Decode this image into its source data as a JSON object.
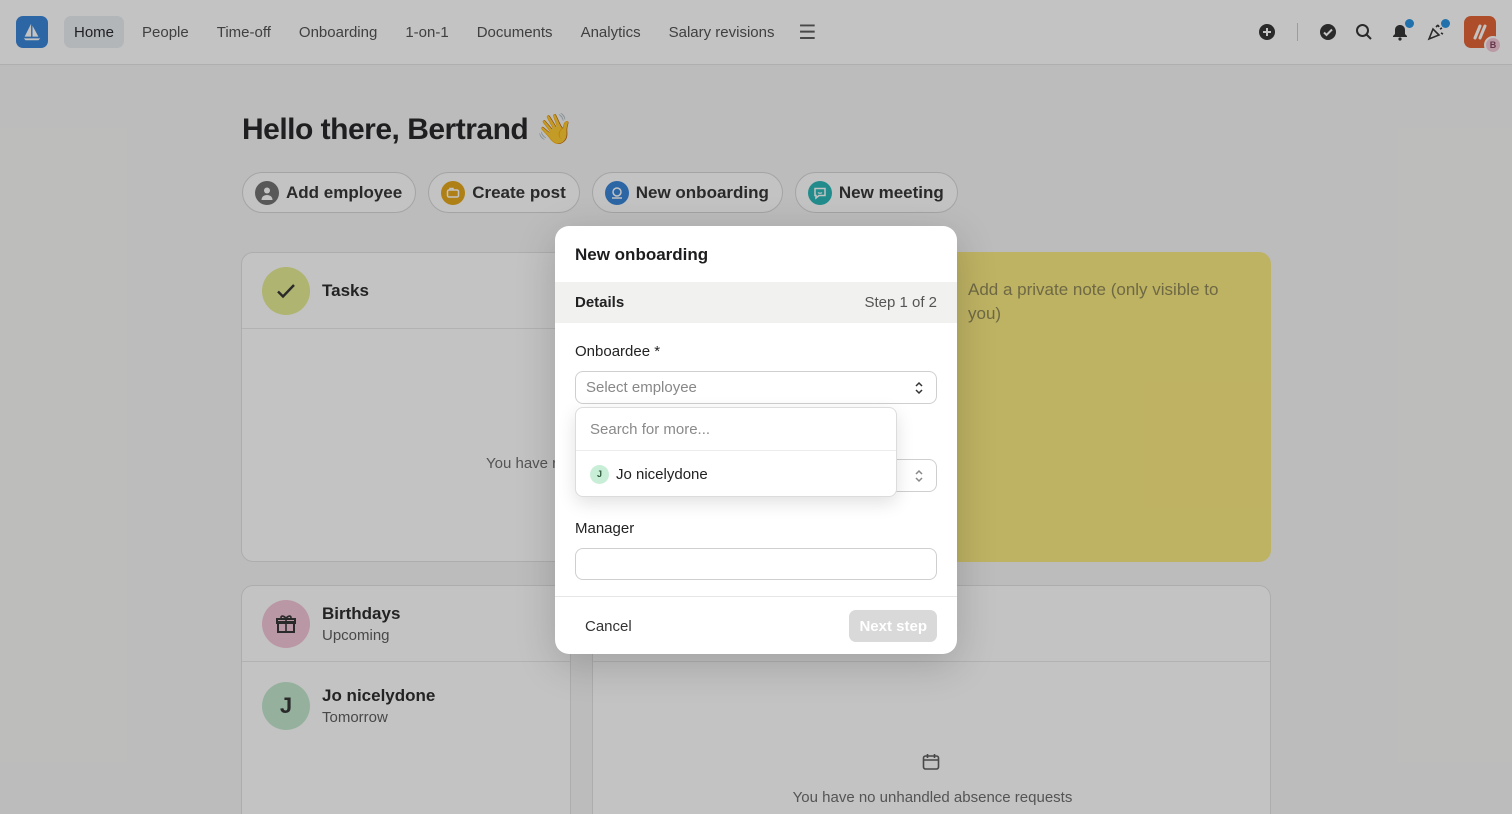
{
  "nav": {
    "items": [
      "Home",
      "People",
      "Time-off",
      "Onboarding",
      "1-on-1",
      "Documents",
      "Analytics",
      "Salary revisions"
    ],
    "active": "Home"
  },
  "user": {
    "avatar_initial": "B"
  },
  "greeting": "Hello there, Bertrand 👋",
  "actions": [
    {
      "label": "Add employee",
      "icon": "person-icon",
      "color": "#6b6b6b"
    },
    {
      "label": "Create post",
      "icon": "megaphone-icon",
      "color": "#e2a20f"
    },
    {
      "label": "New onboarding",
      "icon": "onboarding-icon",
      "color": "#2f7fd6"
    },
    {
      "label": "New meeting",
      "icon": "chat-icon",
      "color": "#20b3b3"
    }
  ],
  "tasks_card": {
    "title": "Tasks",
    "empty_text": "You have r"
  },
  "note": {
    "placeholder": "Add a private note (only visible to you)"
  },
  "birthdays_card": {
    "title": "Birthdays",
    "subtitle": "Upcoming",
    "person": {
      "initial": "J",
      "name": "Jo nicelydone",
      "when": "Tomorrow"
    }
  },
  "absence_card": {
    "empty_text": "You have no unhandled absence requests"
  },
  "modal": {
    "title": "New onboarding",
    "step_name": "Details",
    "step_count": "Step 1 of 2",
    "onboardee_label": "Onboardee *",
    "onboardee_placeholder": "Select employee",
    "manager_label": "Manager",
    "cancel_label": "Cancel",
    "next_label": "Next step"
  },
  "dropdown": {
    "search_placeholder": "Search for more...",
    "options": [
      {
        "initial": "J",
        "name": "Jo nicelydone"
      }
    ]
  },
  "colors": {
    "accent": "#2f7fd6",
    "note": "#f9e87a",
    "tasks_check": "#e4ea8c",
    "birthday": "#f3c2d5",
    "person": "#bfe7cc"
  }
}
